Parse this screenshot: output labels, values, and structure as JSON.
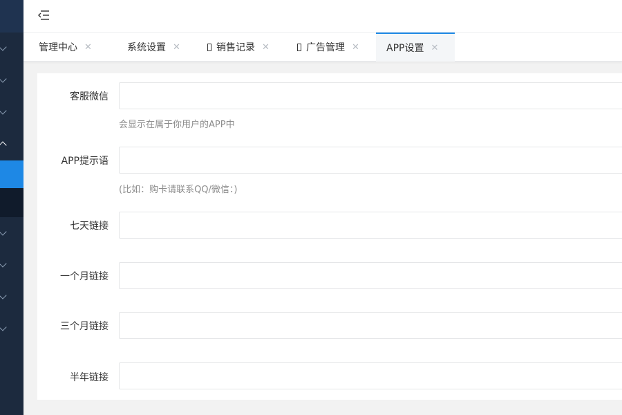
{
  "header": {
    "menu_icon": "menu-fold-icon"
  },
  "sidebar": {
    "chevrons": [
      "down",
      "down",
      "down",
      "up",
      "down",
      "down",
      "down",
      "down"
    ]
  },
  "tabs": [
    {
      "label": "管理中心",
      "close": "✕",
      "has_icon": false
    },
    {
      "label": "系统设置",
      "close": "✕",
      "has_icon": false
    },
    {
      "label": "销售记录",
      "close": "✕",
      "has_icon": true
    },
    {
      "label": "广告管理",
      "close": "✕",
      "has_icon": true
    },
    {
      "label": "APP设置",
      "close": "✕",
      "has_icon": false,
      "active": true
    }
  ],
  "form": {
    "kefu_weixin": {
      "label": "客服微信",
      "value": "",
      "hint": "会显示在属于你用户的APP中"
    },
    "app_tip": {
      "label": "APP提示语",
      "value": "",
      "hint": "(比如：购卡请联系QQ/微信：)"
    },
    "seven_day_link": {
      "label": "七天链接",
      "value": ""
    },
    "one_month_link": {
      "label": "一个月链接",
      "value": ""
    },
    "three_month_link": {
      "label": "三个月链接",
      "value": ""
    },
    "half_year_link": {
      "label": "半年链接",
      "value": ""
    }
  },
  "colors": {
    "accent": "#1e88e5",
    "sidebar": "#1c2a3e",
    "background": "#f2f2f2"
  }
}
